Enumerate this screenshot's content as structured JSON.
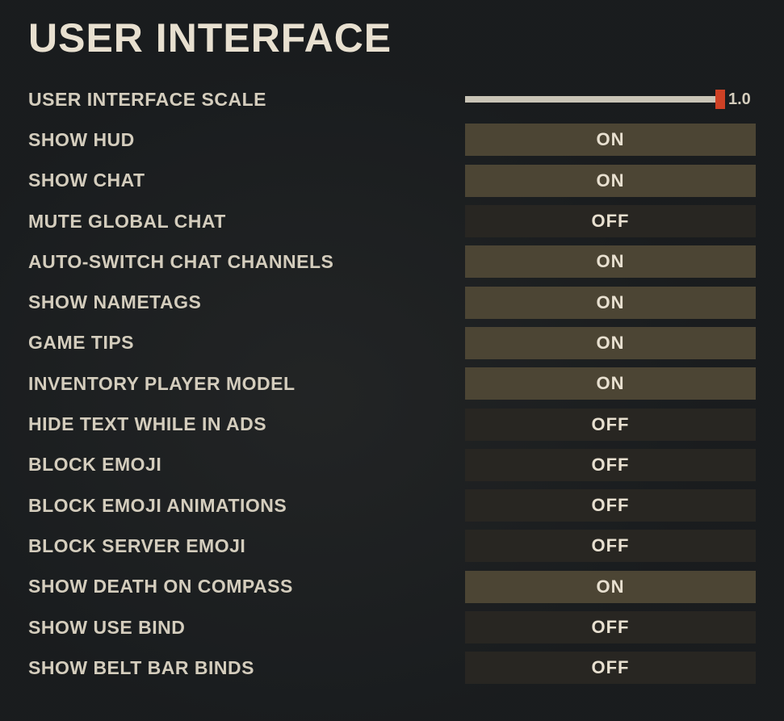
{
  "heading": "USER INTERFACE",
  "slider": {
    "label": "USER INTERFACE SCALE",
    "value": "1.0",
    "fill": 1.0
  },
  "settings": [
    {
      "label": "SHOW HUD",
      "value": "ON",
      "on": true
    },
    {
      "label": "SHOW CHAT",
      "value": "ON",
      "on": true
    },
    {
      "label": "MUTE GLOBAL CHAT",
      "value": "OFF",
      "on": false
    },
    {
      "label": "AUTO-SWITCH CHAT CHANNELS",
      "value": "ON",
      "on": true
    },
    {
      "label": "SHOW NAMETAGS",
      "value": "ON",
      "on": true
    },
    {
      "label": "GAME TIPS",
      "value": "ON",
      "on": true
    },
    {
      "label": "INVENTORY PLAYER MODEL",
      "value": "ON",
      "on": true
    },
    {
      "label": "HIDE TEXT WHILE IN ADS",
      "value": "OFF",
      "on": false
    },
    {
      "label": "BLOCK EMOJI",
      "value": "OFF",
      "on": false
    },
    {
      "label": "BLOCK EMOJI ANIMATIONS",
      "value": "OFF",
      "on": false
    },
    {
      "label": "BLOCK SERVER EMOJI",
      "value": "OFF",
      "on": false
    },
    {
      "label": "SHOW DEATH ON COMPASS",
      "value": "ON",
      "on": true
    },
    {
      "label": "SHOW USE BIND",
      "value": "OFF",
      "on": false
    },
    {
      "label": "SHOW BELT BAR BINDS",
      "value": "OFF",
      "on": false
    }
  ]
}
